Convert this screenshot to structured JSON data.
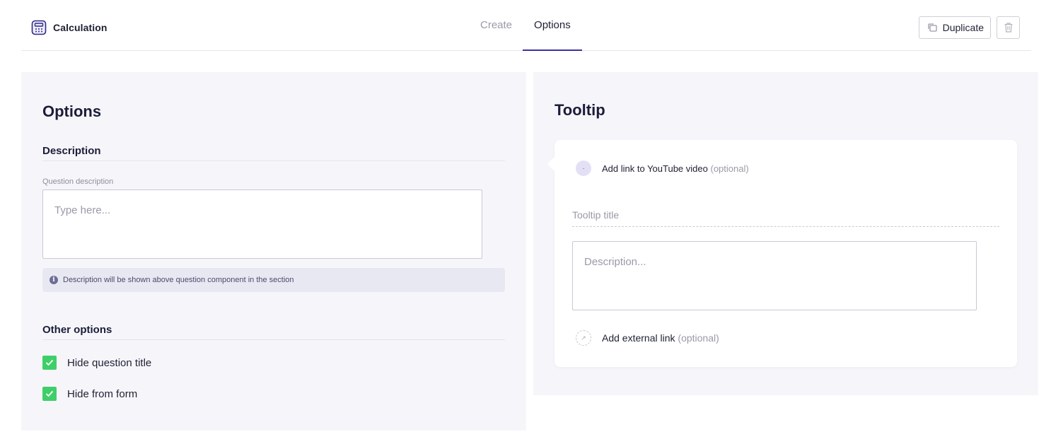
{
  "app": {
    "title": "Calculation",
    "icon": "calculator-icon"
  },
  "tabs": [
    {
      "label": "Create",
      "active": false
    },
    {
      "label": "Options",
      "active": true
    }
  ],
  "actions": {
    "duplicate_label": "Duplicate",
    "duplicate_icon": "copy-icon",
    "delete_icon": "trash-icon"
  },
  "options_panel": {
    "heading": "Options",
    "description": {
      "title": "Description",
      "field_label": "Question description",
      "placeholder": "Type here...",
      "info_text": "Description will be shown above question component in the section"
    },
    "other": {
      "title": "Other options",
      "checkboxes": [
        {
          "label": "Hide question title",
          "checked": true
        },
        {
          "label": "Hide from form",
          "checked": true
        }
      ]
    }
  },
  "tooltip_panel": {
    "heading": "Tooltip",
    "youtube": {
      "label": "Add link to YouTube video",
      "optional": "(optional)"
    },
    "title_placeholder": "Tooltip title",
    "description_placeholder": "Description...",
    "external": {
      "label": "Add external link",
      "optional": "(optional)"
    }
  },
  "colors": {
    "accent": "#3b2fa8",
    "checkbox": "#3fcf6a",
    "panel_bg": "#f6f6fa",
    "info_bg": "#e8e8f3"
  }
}
